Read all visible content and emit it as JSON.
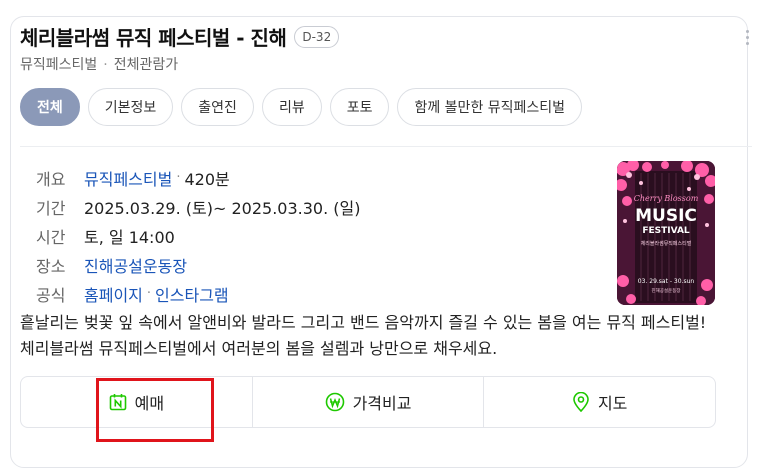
{
  "event": {
    "title": "체리블라썸 뮤직 페스티벌 - 진해",
    "dday": "D-32",
    "category": "뮤직페스티벌",
    "rating": "전체관람가"
  },
  "tabs": [
    {
      "label": "전체",
      "active": true
    },
    {
      "label": "기본정보"
    },
    {
      "label": "출연진"
    },
    {
      "label": "리뷰"
    },
    {
      "label": "포토"
    },
    {
      "label": "함께 볼만한 뮤직페스티벌"
    }
  ],
  "info": {
    "overview": {
      "label": "개요",
      "genre": "뮤직페스티벌",
      "duration": "420분"
    },
    "period": {
      "label": "기간",
      "value": "2025.03.29. (토)~ 2025.03.30. (일)"
    },
    "time": {
      "label": "시간",
      "value": "토, 일 14:00"
    },
    "venue": {
      "label": "장소",
      "value": "진해공설운동장"
    },
    "official": {
      "label": "공식",
      "homepage": "홈페이지",
      "instagram": "인스타그램"
    }
  },
  "poster": {
    "line1": "Cherry Blossom",
    "line2": "MUSIC",
    "line3": "FESTIVAL",
    "line4": "체리블라썸뮤직페스티벌",
    "dates": "03. 29.sat - 30.sun",
    "venue": "진해공설운동장",
    "colors": {
      "bg": "#4a1535",
      "pink": "#ff5fa8",
      "light": "#ffc3de"
    }
  },
  "description": "흩날리는 벚꽃 잎 속에서 알앤비와 발라드 그리고 밴드 음악까지 즐길 수 있는 봄을 여는 뮤직 페스티벌! 체리블라썸 뮤직페스티벌에서 여러분의 봄을 설렘과 낭만으로 채우세요.",
  "actions": {
    "book": {
      "label": "예매",
      "icon": "naver-calendar-icon",
      "color": "#1ec800"
    },
    "compare": {
      "label": "가격비교",
      "icon": "won-icon",
      "color": "#1ec800"
    },
    "map": {
      "label": "지도",
      "icon": "map-pin-icon",
      "color": "#1ec800"
    }
  }
}
